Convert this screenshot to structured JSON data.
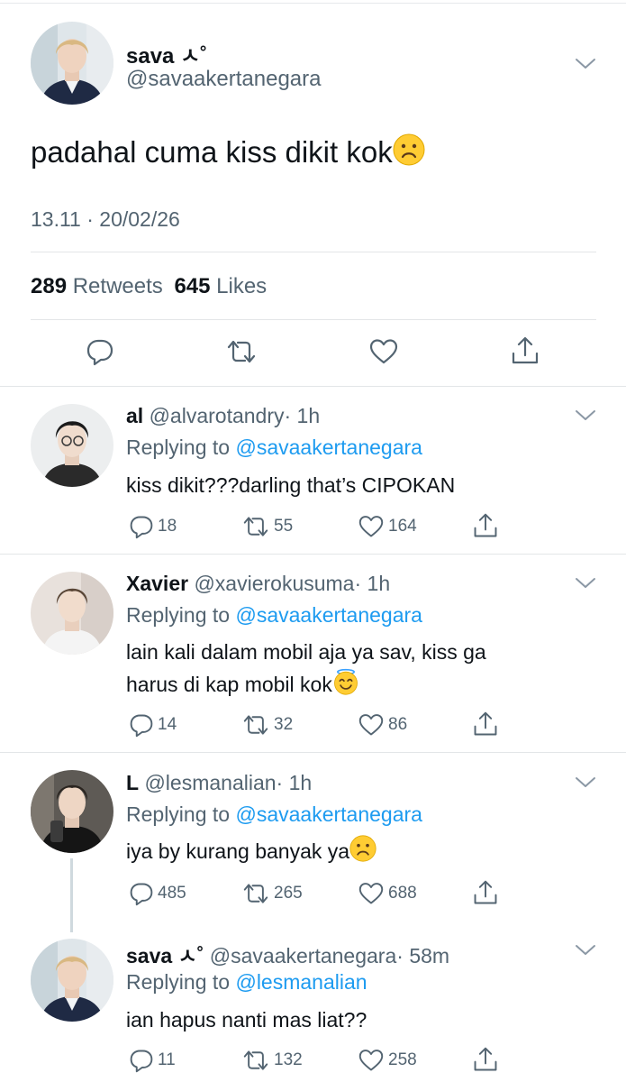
{
  "main_tweet": {
    "name": "sava",
    "name_deco": "ㅅ˚",
    "handle": "@savaakertanegara",
    "text": "padahal cuma kiss dikit kok",
    "emoji": "frowning-face",
    "timestamp": "13.11 · 20/02/26",
    "retweets_count": "289",
    "retweets_label": "Retweets",
    "likes_count": "645",
    "likes_label": "Likes"
  },
  "replies": [
    {
      "name": "al",
      "handle": "@alvarotandry",
      "time": "· 1h",
      "replying_prefix": "Replying to",
      "replying_to": "@savaakertanegara",
      "text": "kiss dikit???darling that’s CIPOKAN",
      "replies": "18",
      "retweets": "55",
      "likes": "164"
    },
    {
      "name": "Xavier",
      "handle": "@xavierokusuma",
      "time": "· 1h",
      "replying_prefix": "Replying to",
      "replying_to": "@savaakertanegara",
      "text_line1": "lain kali dalam mobil aja ya sav, kiss ga",
      "text_line2": "harus di kap mobil kok",
      "emoji": "smiling-face-with-halo",
      "replies": "14",
      "retweets": "32",
      "likes": "86"
    },
    {
      "name": "L",
      "handle": "@lesmanalian",
      "time": "· 1h",
      "replying_prefix": "Replying to",
      "replying_to": "@savaakertanegara",
      "text": "iya by kurang banyak ya",
      "emoji": "frowning-face",
      "replies": "485",
      "retweets": "265",
      "likes": "688"
    },
    {
      "name": "sava",
      "name_deco": "ㅅ˚",
      "handle": "@savaakertanegara",
      "time": "· 58m",
      "replying_prefix": "Replying to",
      "replying_to": "@lesmanalian",
      "text": "ian hapus nanti mas liat??",
      "replies": "11",
      "retweets": "132",
      "likes": "258"
    }
  ],
  "colors": {
    "text": "#0f1419",
    "secondary": "#536471",
    "link": "#1d9bf0",
    "divider": "#e3e6e8"
  },
  "icons": [
    "chevron-down-icon",
    "reply-icon",
    "retweet-icon",
    "like-icon",
    "share-icon"
  ]
}
